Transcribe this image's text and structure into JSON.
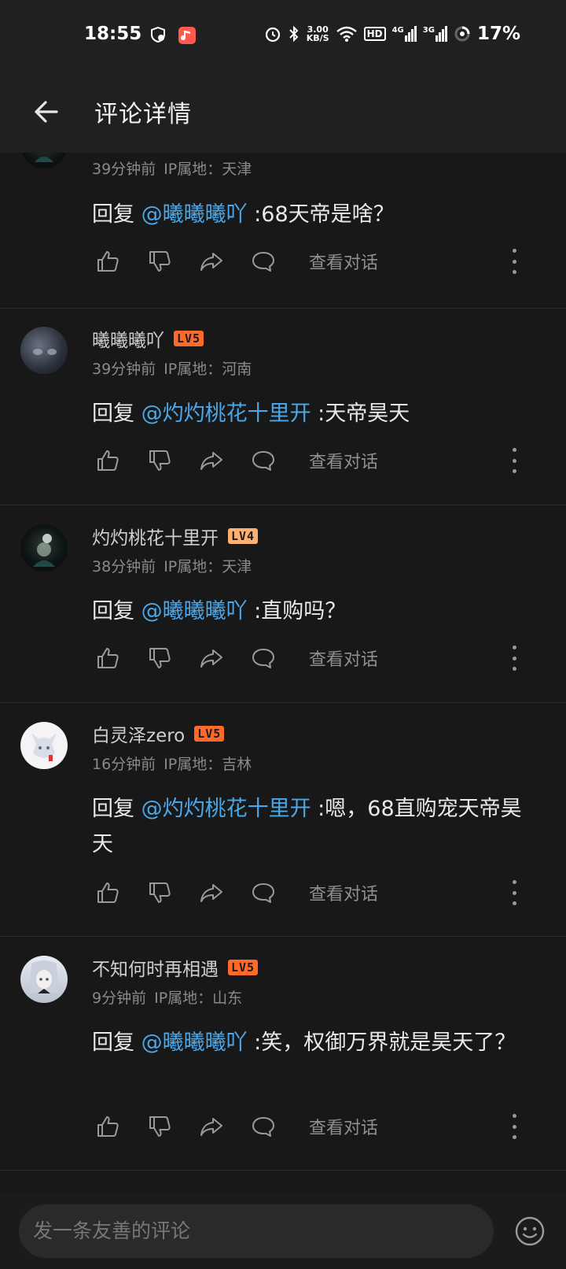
{
  "status_bar": {
    "time": "18:55",
    "net_speed_value": "3.00",
    "net_speed_unit": "KB/S",
    "hd_label": "HD",
    "sim1_label": "4G",
    "sim2_label": "3G",
    "battery_percent": "17%"
  },
  "header": {
    "title": "评论详情"
  },
  "comments": [
    {
      "username": "",
      "time": "39分钟前",
      "ip": "IP属地：天津",
      "reply_prefix": "回复 ",
      "mention": "@曦曦曦吖",
      "reply_text": " :68天帝是啥？",
      "view_label": "查看对话"
    },
    {
      "username": "曦曦曦吖",
      "level": "LV5",
      "time": "39分钟前",
      "ip": "IP属地：河南",
      "reply_prefix": "回复 ",
      "mention": "@灼灼桃花十里开",
      "reply_text": " :天帝昊天",
      "view_label": "查看对话"
    },
    {
      "username": "灼灼桃花十里开",
      "level": "LV4",
      "time": "38分钟前",
      "ip": "IP属地：天津",
      "reply_prefix": "回复 ",
      "mention": "@曦曦曦吖",
      "reply_text": " :直购吗？",
      "view_label": "查看对话"
    },
    {
      "username": "白灵泽zero",
      "level": "LV5",
      "time": "16分钟前",
      "ip": "IP属地：吉林",
      "reply_prefix": "回复 ",
      "mention": "@灼灼桃花十里开",
      "reply_text": " :嗯，68直购宠天帝昊天",
      "view_label": "查看对话"
    },
    {
      "username": "不知何时再相遇",
      "level": "LV5",
      "time": "9分钟前",
      "ip": "IP属地：山东",
      "reply_prefix": "回复 ",
      "mention": "@曦曦曦吖",
      "reply_text": " :笑，权御万界就是昊天了？",
      "view_label": "查看对话"
    }
  ],
  "bottom_bar": {
    "input_placeholder": "发一条友善的评论"
  },
  "colors": {
    "background": "#181818",
    "mention": "#4aa8ea",
    "lv5_badge": "#ff6a2a",
    "lv4_badge": "#ffb070"
  }
}
